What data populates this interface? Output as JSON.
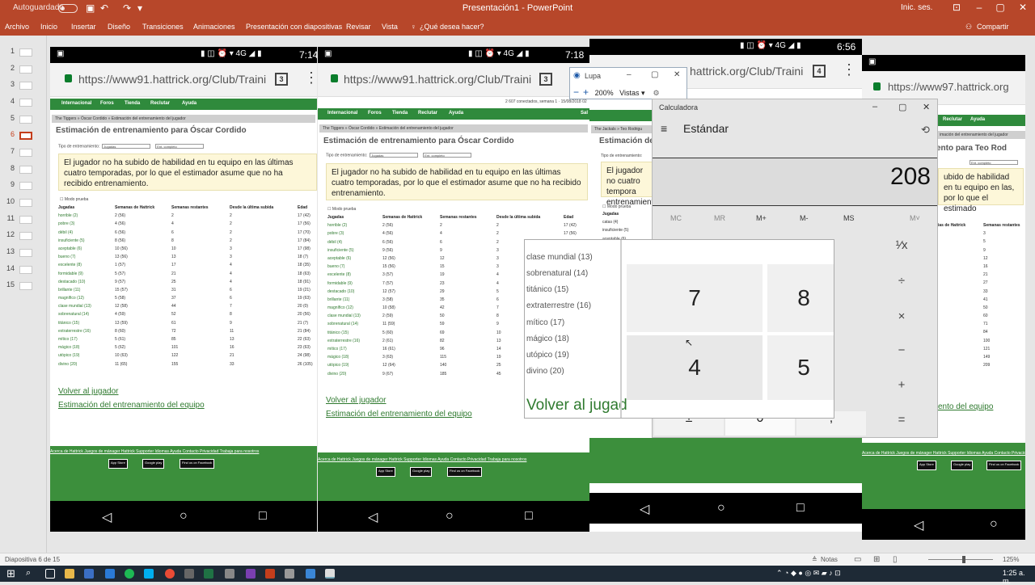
{
  "app": {
    "autosave_label": "Autoguardado",
    "title": "Presentación1 - PowerPoint",
    "signin": "Inic. ses.",
    "share": "Compartir",
    "accent": "#b7472a"
  },
  "ribbon_tabs": [
    "Archivo",
    "Inicio",
    "Insertar",
    "Diseño",
    "Transiciones",
    "Animaciones",
    "Presentación con diapositivas",
    "Revisar",
    "Vista",
    "¿Qué desea hacer?"
  ],
  "slides": [
    "1",
    "2",
    "3",
    "4",
    "5",
    "6",
    "7",
    "8",
    "9",
    "10",
    "11",
    "12",
    "13",
    "14",
    "15"
  ],
  "phones": [
    {
      "time": "7:14",
      "url": "https://www91.hattrick.org/Club/Traini",
      "tabs": "3",
      "nav": [
        "Internacional",
        "Foros",
        "Tienda",
        "Reclutar",
        "Ayuda"
      ],
      "crumbs": "The Tiggers » Óscar Cordido » Estimación del entrenamiento del jugador",
      "title": "Estimación de entrenamiento para Óscar Cordido",
      "training_label": "Tipo de entrenamiento:",
      "training_value": "Jugadas",
      "intensity_value": "Ent. completo",
      "note": "El jugador no ha subido de habilidad en tu equipo en las últimas cuatro temporadas, por lo que el estimador asume que no ha recibido entrenamiento.",
      "checkbox": "Modo prueba",
      "headers": [
        "Jugadas",
        "Semanas de Hattrick",
        "Semanas restantes",
        "Desde la última subida",
        "Edad"
      ],
      "rows": [
        [
          "horrible (2)",
          "2 (56)",
          "2",
          "2",
          "17 (42)"
        ],
        [
          "pobre (3)",
          "4 (56)",
          "4",
          "2",
          "17 (56)"
        ],
        [
          "débil (4)",
          "6 (56)",
          "6",
          "2",
          "17 (70)"
        ],
        [
          "insuficiente (5)",
          "8 (56)",
          "8",
          "2",
          "17 (84)"
        ],
        [
          "aceptable (6)",
          "10 (56)",
          "10",
          "3",
          "17 (98)"
        ],
        [
          "bueno (7)",
          "13 (56)",
          "13",
          "3",
          "18 (7)"
        ],
        [
          "excelente (8)",
          "1 (57)",
          "17",
          "4",
          "18 (35)"
        ],
        [
          "formidable (9)",
          "5 (57)",
          "21",
          "4",
          "18 (63)"
        ],
        [
          "destacado (10)",
          "9 (57)",
          "25",
          "4",
          "18 (91)"
        ],
        [
          "brillante (11)",
          "15 (57)",
          "31",
          "6",
          "19 (21)"
        ],
        [
          "magnífico (12)",
          "5 (58)",
          "37",
          "6",
          "19 (63)"
        ],
        [
          "clase mundial (13)",
          "12 (58)",
          "44",
          "7",
          "20 (0)"
        ],
        [
          "sobrenatural (14)",
          "4 (59)",
          "52",
          "8",
          "20 (56)"
        ],
        [
          "titánico (15)",
          "13 (59)",
          "61",
          "9",
          "21 (7)"
        ],
        [
          "extraterrestre (16)",
          "8 (60)",
          "72",
          "11",
          "21 (84)"
        ],
        [
          "mítico (17)",
          "5 (61)",
          "85",
          "13",
          "22 (63)"
        ],
        [
          "mágico (18)",
          "5 (62)",
          "101",
          "16",
          "23 (63)"
        ],
        [
          "utópico (19)",
          "10 (63)",
          "122",
          "21",
          "24 (98)"
        ],
        [
          "divino (20)",
          "11 (65)",
          "155",
          "33",
          "26 (105)"
        ]
      ],
      "back_link": "Volver al jugador",
      "team_link": "Estimación del entrenamiento del equipo"
    },
    {
      "time": "7:18",
      "url": "https://www91.hattrick.org/Club/Traini",
      "tabs": "3",
      "topline": "2 607 conectados, semana 1 · 15/08/2018 02",
      "nav": [
        "Internacional",
        "Foros",
        "Tienda",
        "Reclutar",
        "Ayuda",
        "Sal"
      ],
      "crumbs": "The Tiggers » Óscar Cordido » Estimación del entrenamiento del jugador",
      "title": "Estimación de entrenamiento para Óscar Cordido",
      "training_label": "Tipo de entrenamiento:",
      "training_value": "Jugadas",
      "intensity_value": "Ent. completo",
      "note": "El jugador no ha subido de habilidad en tu equipo en las últimas cuatro temporadas, por lo que el estimador asume que no ha recibido entrenamiento.",
      "checkbox": "Modo prueba",
      "headers": [
        "Jugadas",
        "Semanas de Hattrick",
        "Semanas restantes",
        "Desde la última subida",
        "Edad"
      ],
      "rows": [
        [
          "horrible (2)",
          "2 (56)",
          "2",
          "2",
          "17 (42)"
        ],
        [
          "pobre (3)",
          "4 (56)",
          "4",
          "2",
          "17 (56)"
        ],
        [
          "débil (4)",
          "6 (56)",
          "6",
          "2",
          "17 (70)"
        ],
        [
          "insuficiente (5)",
          "9 (56)",
          "9",
          "3",
          ""
        ],
        [
          "aceptable (6)",
          "12 (56)",
          "12",
          "3",
          ""
        ],
        [
          "bueno (7)",
          "15 (56)",
          "15",
          "3",
          ""
        ],
        [
          "excelente (8)",
          "3 (57)",
          "19",
          "4",
          ""
        ],
        [
          "formidable (9)",
          "7 (57)",
          "23",
          "4",
          ""
        ],
        [
          "destacado (10)",
          "12 (57)",
          "29",
          "5",
          ""
        ],
        [
          "brillante (11)",
          "3 (58)",
          "35",
          "6",
          ""
        ],
        [
          "magnífico (12)",
          "10 (58)",
          "42",
          "7",
          ""
        ],
        [
          "clase mundial (13)",
          "2 (59)",
          "50",
          "8",
          ""
        ],
        [
          "sobrenatural (14)",
          "11 (59)",
          "59",
          "9",
          ""
        ],
        [
          "titánico (15)",
          "5 (60)",
          "69",
          "10",
          ""
        ],
        [
          "extraterrestre (16)",
          "2 (61)",
          "82",
          "13",
          ""
        ],
        [
          "mítico (17)",
          "16 (61)",
          "96",
          "14",
          ""
        ],
        [
          "mágico (18)",
          "3 (63)",
          "115",
          "19",
          ""
        ],
        [
          "utópico (19)",
          "12 (64)",
          "140",
          "25",
          ""
        ],
        [
          "divino (20)",
          "9 (67)",
          "185",
          "45",
          ""
        ]
      ],
      "back_link": "Volver al jugador",
      "team_link": "Estimación del entrenamiento del equipo"
    },
    {
      "time": "6:56",
      "url": "hattrick.org/Club/Traini",
      "tabs": "4",
      "crumbs": "The Jackals » Teo Rodrigu",
      "title": "Estimación de",
      "training_label": "Tipo de entrenamiento:",
      "note": "El jugador no cuatro tempora entrenamiento",
      "checkbox": "Modo prueba",
      "rows": [
        "Jugadas",
        "catas (4)",
        "insuficiente (5)",
        "aceptable (6)"
      ]
    },
    {
      "url": "https://www97.hattrick.org",
      "nav": [
        "Reclutar",
        "Ayuda"
      ],
      "crumbs": "imación del entrenamiento del jugador",
      "title": "ento para Teo Rod",
      "intensity_value": "Ent. completo",
      "note": "ubido de habilidad en tu equipo en las, por lo que el estimado",
      "headers": [
        "ias de Hattrick",
        "Semanas restantes"
      ],
      "rows": [
        [
          "",
          "3"
        ],
        [
          "",
          "5"
        ],
        [
          "",
          "9"
        ],
        [
          "",
          "12"
        ],
        [
          "",
          "16"
        ],
        [
          "",
          "21"
        ],
        [
          "",
          "27"
        ],
        [
          "",
          "33"
        ],
        [
          "",
          "41"
        ],
        [
          "",
          "50"
        ],
        [
          "",
          "60"
        ],
        [
          "",
          "71"
        ],
        [
          "",
          "84"
        ],
        [
          "",
          "100"
        ],
        [
          "",
          "121"
        ],
        [
          "",
          "149"
        ],
        [
          "",
          "209"
        ]
      ],
      "team_link": "ento del equipo"
    }
  ],
  "footer": {
    "links": "Acerca de Hattrick   Juegos de mánager   Hattrick Supporter   Idiomas   Ayuda   Contacto   Privacidad   Trabaja para nosotros",
    "badges": [
      "App Store",
      "Google play",
      "Find us on Facebook"
    ]
  },
  "lupa": {
    "title": "Lupa",
    "zoom": "200%",
    "views": "Vistas"
  },
  "calculator": {
    "title": "Calculadora",
    "mode": "Estándar",
    "display": "208",
    "memory": [
      "MC",
      "MR",
      "M+",
      "M-",
      "MS",
      "M˅"
    ],
    "ops": [
      "¹⁄x",
      "÷",
      "×",
      "−",
      "+",
      "="
    ],
    "bottom": [
      "±",
      "0",
      ","
    ]
  },
  "magnifier": {
    "list": [
      "clase mundial (13)",
      "sobrenatural (14)",
      "titánico (15)",
      "extraterrestre (16)",
      "mítico (17)",
      "mágico (18)",
      "utópico (19)",
      "divino (20)"
    ],
    "link": "Volver al jugad",
    "keys": [
      "7",
      "8",
      "4",
      "5"
    ]
  },
  "status": {
    "slide": "Diapositiva 6 de 15",
    "notes": "Notas",
    "zoom": "125%"
  },
  "taskbar": {
    "clock": "1:25 a. m."
  }
}
